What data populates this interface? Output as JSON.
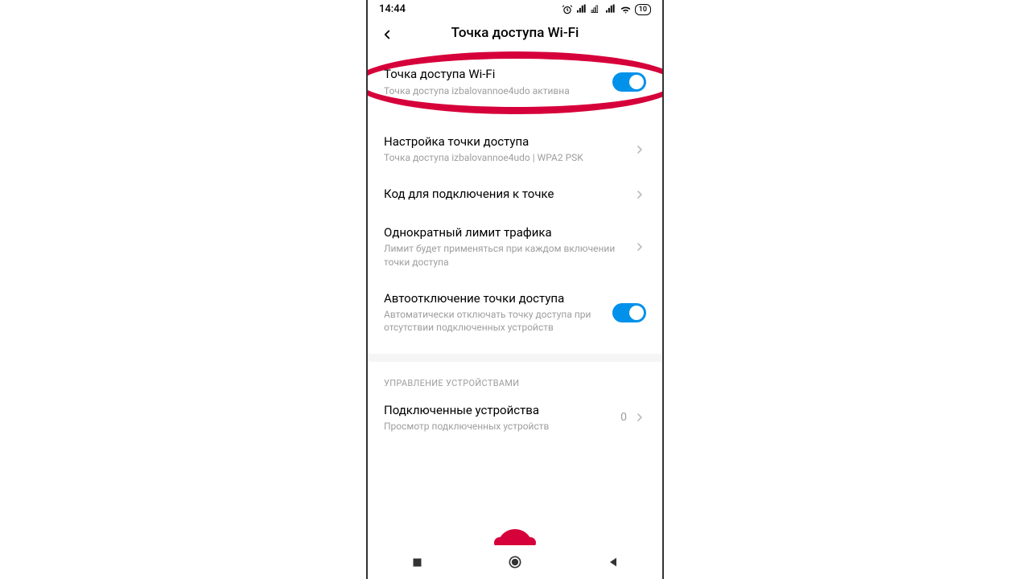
{
  "status": {
    "time": "14:44",
    "battery": "10"
  },
  "header": {
    "title": "Точка доступа Wi-Fi"
  },
  "rows": {
    "hotspot": {
      "title": "Точка доступа Wi-Fi",
      "sub": "Точка доступа izbalovannoe4udo активна"
    },
    "setup": {
      "title": "Настройка точки доступа",
      "sub": "Точка доступа izbalovannoe4udo | WPA2 PSK"
    },
    "code": {
      "title": "Код для подключения к точке"
    },
    "limit": {
      "title": "Однократный лимит трафика",
      "sub": "Лимит будет применяться при каждом включении точки доступа"
    },
    "autooff": {
      "title": "Автоотключение точки доступа",
      "sub": "Автоматически отключать точку доступа при отсутствии подключенных устройств"
    },
    "devices": {
      "title": "Подключенные устройства",
      "sub": "Просмотр подключенных устройств",
      "count": "0"
    }
  },
  "section": {
    "devices_header": "УПРАВЛЕНИЕ УСТРОЙСТВАМИ"
  }
}
